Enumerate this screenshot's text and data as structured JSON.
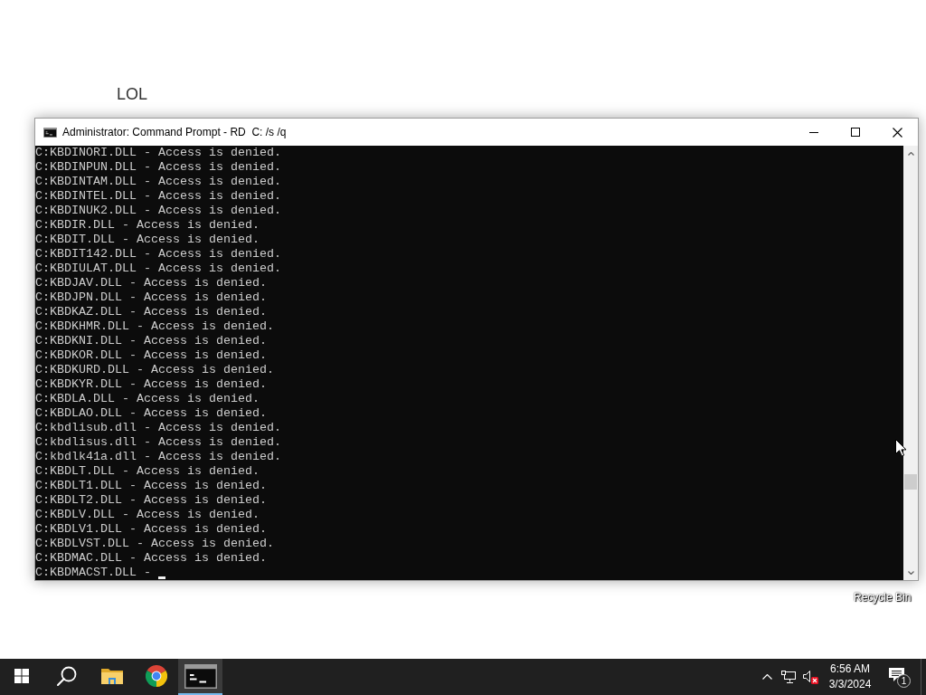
{
  "desktop": {
    "note": "LOL",
    "recycle_bin_label": "Recycle Bin"
  },
  "window": {
    "title": "Administrator: Command Prompt - RD  C: /s /q",
    "cursor": true,
    "lines": [
      "C:KBDINORI.DLL - Access is denied.",
      "C:KBDINPUN.DLL - Access is denied.",
      "C:KBDINTAM.DLL - Access is denied.",
      "C:KBDINTEL.DLL - Access is denied.",
      "C:KBDINUK2.DLL - Access is denied.",
      "C:KBDIR.DLL - Access is denied.",
      "C:KBDIT.DLL - Access is denied.",
      "C:KBDIT142.DLL - Access is denied.",
      "C:KBDIULAT.DLL - Access is denied.",
      "C:KBDJAV.DLL - Access is denied.",
      "C:KBDJPN.DLL - Access is denied.",
      "C:KBDKAZ.DLL - Access is denied.",
      "C:KBDKHMR.DLL - Access is denied.",
      "C:KBDKNI.DLL - Access is denied.",
      "C:KBDKOR.DLL - Access is denied.",
      "C:KBDKURD.DLL - Access is denied.",
      "C:KBDKYR.DLL - Access is denied.",
      "C:KBDLA.DLL - Access is denied.",
      "C:KBDLAO.DLL - Access is denied.",
      "C:kbdlisub.dll - Access is denied.",
      "C:kbdlisus.dll - Access is denied.",
      "C:kbdlk41a.dll - Access is denied.",
      "C:KBDLT.DLL - Access is denied.",
      "C:KBDLT1.DLL - Access is denied.",
      "C:KBDLT2.DLL - Access is denied.",
      "C:KBDLV.DLL - Access is denied.",
      "C:KBDLV1.DLL - Access is denied.",
      "C:KBDLVST.DLL - Access is denied.",
      "C:KBDMAC.DLL - Access is denied.",
      "C:KBDMACST.DLL -"
    ]
  },
  "taskbar": {
    "buttons": [
      {
        "kind": "start",
        "selected": false
      },
      {
        "kind": "search",
        "selected": false
      },
      {
        "kind": "folder",
        "selected": false
      },
      {
        "kind": "browser",
        "selected": false
      },
      {
        "kind": "terminal",
        "selected": true
      }
    ],
    "tray": {
      "volume_muted": true,
      "time": "6:56 AM",
      "date": "3/3/2024",
      "notification_count": "1"
    }
  }
}
